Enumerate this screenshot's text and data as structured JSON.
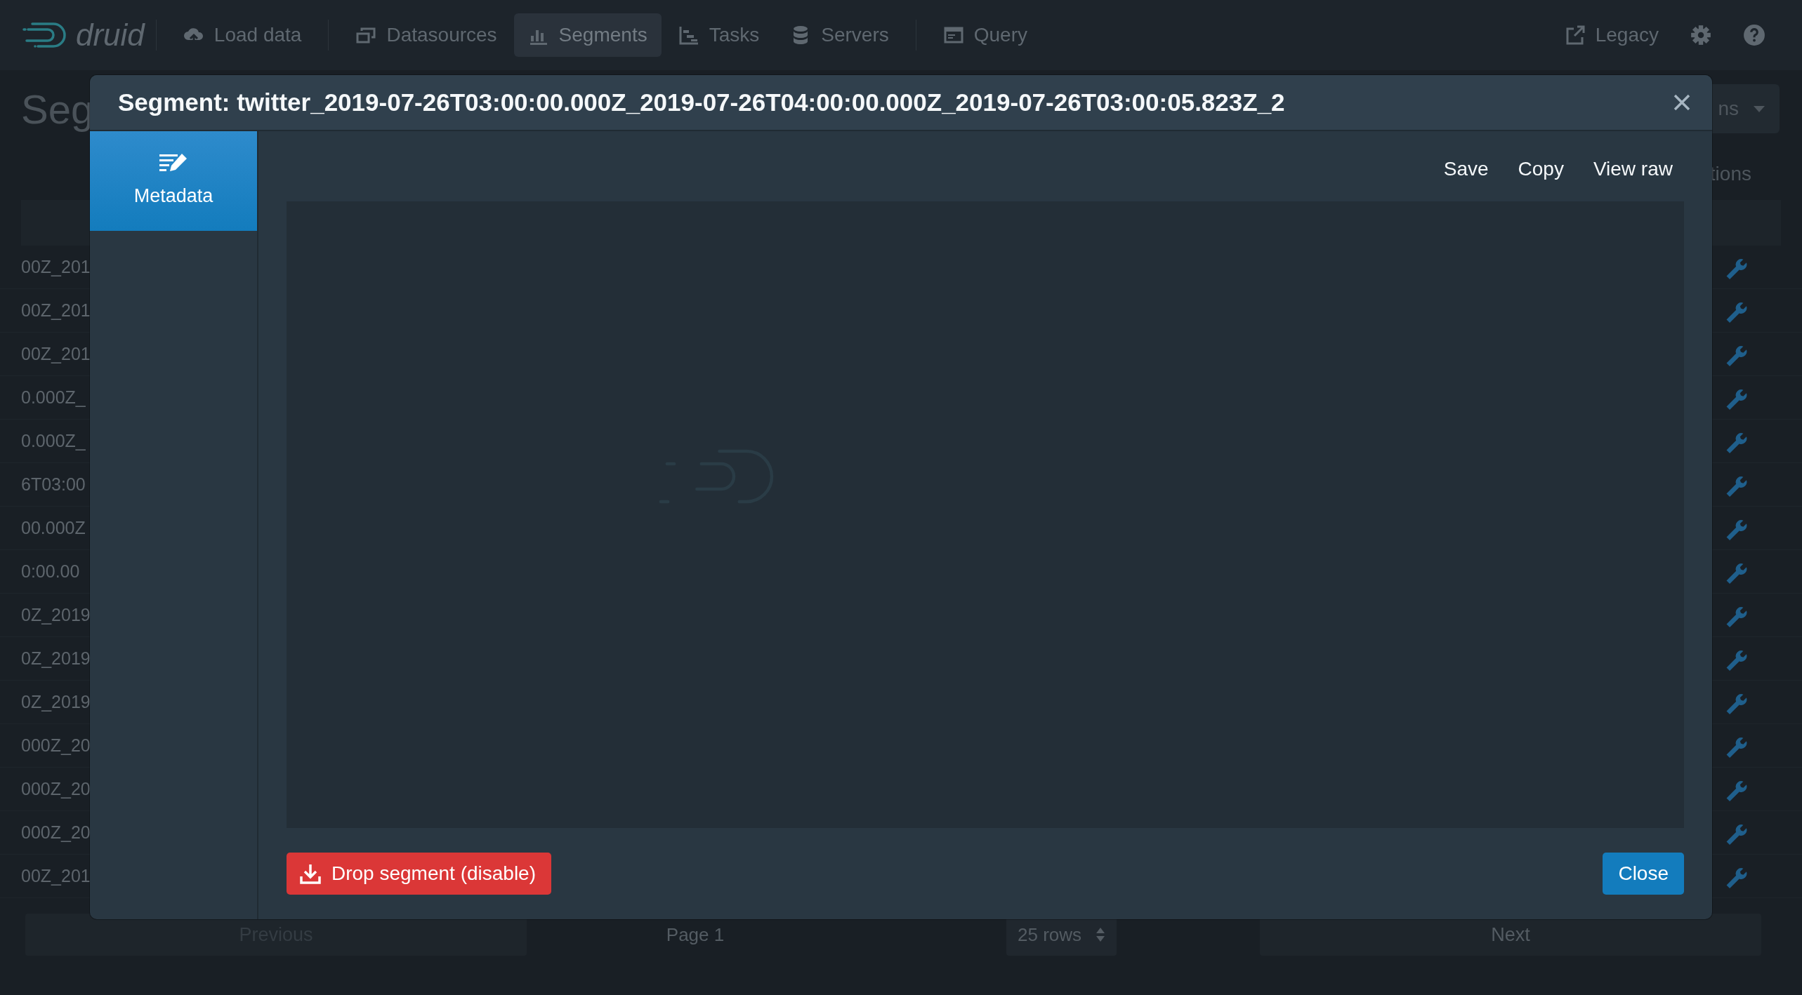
{
  "navbar": {
    "logo_text": "druid",
    "items": [
      {
        "label": "Load data",
        "selected": false
      },
      {
        "label": "Datasources",
        "selected": false
      },
      {
        "label": "Segments",
        "selected": true
      },
      {
        "label": "Tasks",
        "selected": false
      },
      {
        "label": "Servers",
        "selected": false
      },
      {
        "label": "Query",
        "selected": false
      }
    ],
    "legacy": "Legacy"
  },
  "page": {
    "title": "Seg",
    "dropdown_label": "ns",
    "column_header": "tions",
    "rows": [
      {
        "segment": "00Z_201"
      },
      {
        "segment": "00Z_201"
      },
      {
        "segment": "00Z_201"
      },
      {
        "segment": "0.000Z_"
      },
      {
        "segment": "0.000Z_"
      },
      {
        "segment": "6T03:00"
      },
      {
        "segment": "00.000Z"
      },
      {
        "segment": "0:00.00"
      },
      {
        "segment": "0Z_2019"
      },
      {
        "segment": "0Z_2019"
      },
      {
        "segment": "0Z_2019"
      },
      {
        "segment": "000Z_20"
      },
      {
        "segment": "000Z_20"
      },
      {
        "segment": "000Z_20"
      },
      {
        "segment": "00Z_201"
      }
    ]
  },
  "pagination": {
    "previous": {
      "label": "Previous",
      "disabled": true
    },
    "page": "Page 1",
    "rows_select": "25 rows",
    "next": {
      "label": "Next",
      "disabled": false
    }
  },
  "modal": {
    "title": "Segment: twitter_2019-07-26T03:00:00.000Z_2019-07-26T04:00:00.000Z_2019-07-26T03:00:05.823Z_2",
    "tabs": [
      {
        "label": "Metadata",
        "selected": true
      }
    ],
    "actions": [
      "Save",
      "Copy",
      "View raw"
    ],
    "drop_button": "Drop segment (disable)",
    "close_button": "Close"
  }
}
